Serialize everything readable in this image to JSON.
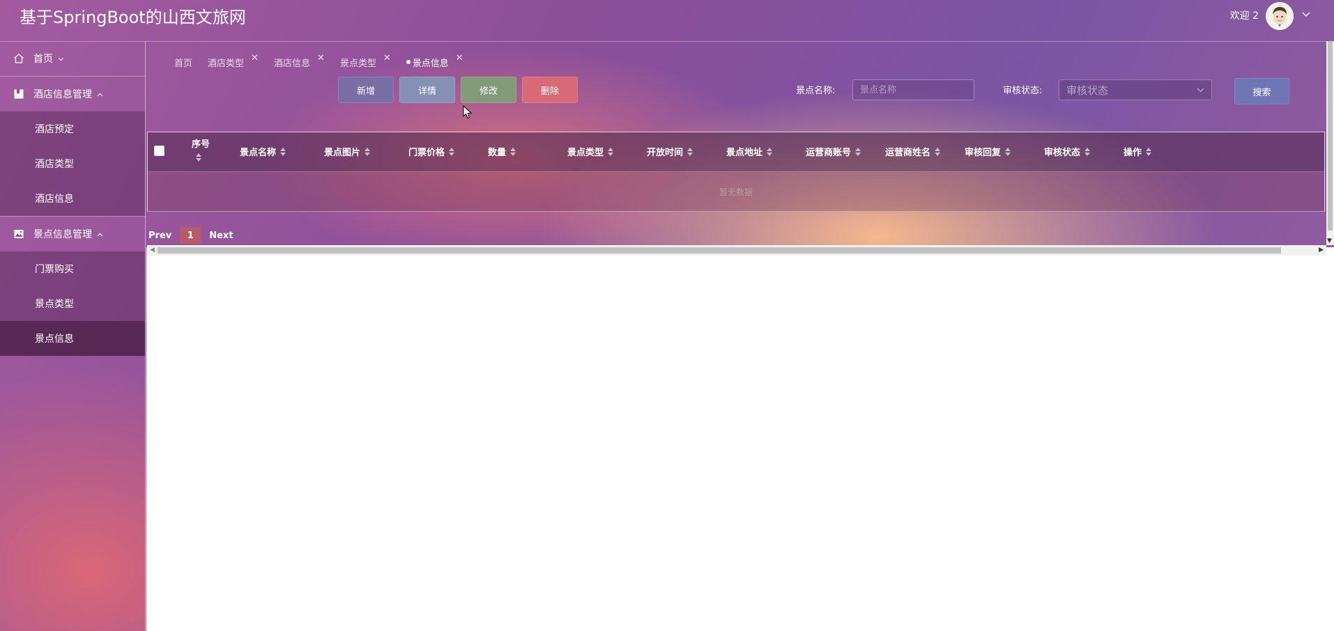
{
  "app": {
    "title": "基于SpringBoot的山西文旅网",
    "welcome": "欢迎 2"
  },
  "sidebar": {
    "home": "首页",
    "groups": [
      {
        "label": "酒店信息管理",
        "items": [
          "酒店预定",
          "酒店类型",
          "酒店信息"
        ]
      },
      {
        "label": "景点信息管理",
        "items": [
          "门票购买",
          "景点类型",
          "景点信息"
        ]
      }
    ],
    "active_item": "景点信息"
  },
  "tabs": [
    {
      "label": "首页",
      "closable": false
    },
    {
      "label": "酒店类型",
      "closable": true
    },
    {
      "label": "酒店信息",
      "closable": true
    },
    {
      "label": "景点类型",
      "closable": true
    },
    {
      "label": "景点信息",
      "closable": true,
      "active": true
    }
  ],
  "toolbar": {
    "add": "新增",
    "detail": "详情",
    "edit": "修改",
    "delete": "删除"
  },
  "search": {
    "name_label": "景点名称:",
    "name_placeholder": "景点名称",
    "status_label": "审核状态:",
    "status_placeholder": "审核状态",
    "button": "搜索"
  },
  "table": {
    "columns": [
      "序号",
      "景点名称",
      "景点图片",
      "门票价格",
      "数量",
      "景点类型",
      "开放时间",
      "景点地址",
      "运营商账号",
      "运营商姓名",
      "审核回复",
      "审核状态",
      "操作"
    ],
    "empty_text": "暂无数据"
  },
  "pagination": {
    "prev": "Prev",
    "current": "1",
    "next": "Next"
  },
  "colors": {
    "add_button": "#7a6ea7",
    "detail_button": "#8690b5",
    "edit_button": "#829a78",
    "delete_button": "#d86a78",
    "search_button": "#6f76b3",
    "page_active": "#b85a6a"
  }
}
